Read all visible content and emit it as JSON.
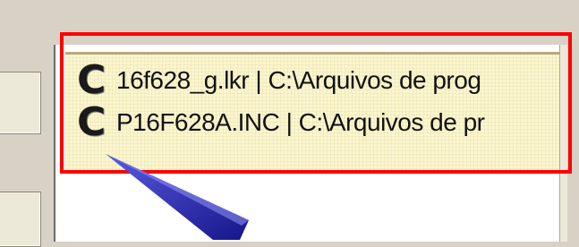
{
  "list": {
    "items": [
      {
        "icon": "c-file-icon",
        "icon_glyph": "C",
        "label": "16f628_g.lkr | C:\\Arquivos de prog"
      },
      {
        "icon": "c-file-icon",
        "icon_glyph": "C",
        "label": "P16F628A.INC | C:\\Arquivos de pr"
      }
    ]
  },
  "colors": {
    "highlight": "#ff0000",
    "list_background": "#fbf6cf",
    "pointer": "#2a2ab8"
  }
}
